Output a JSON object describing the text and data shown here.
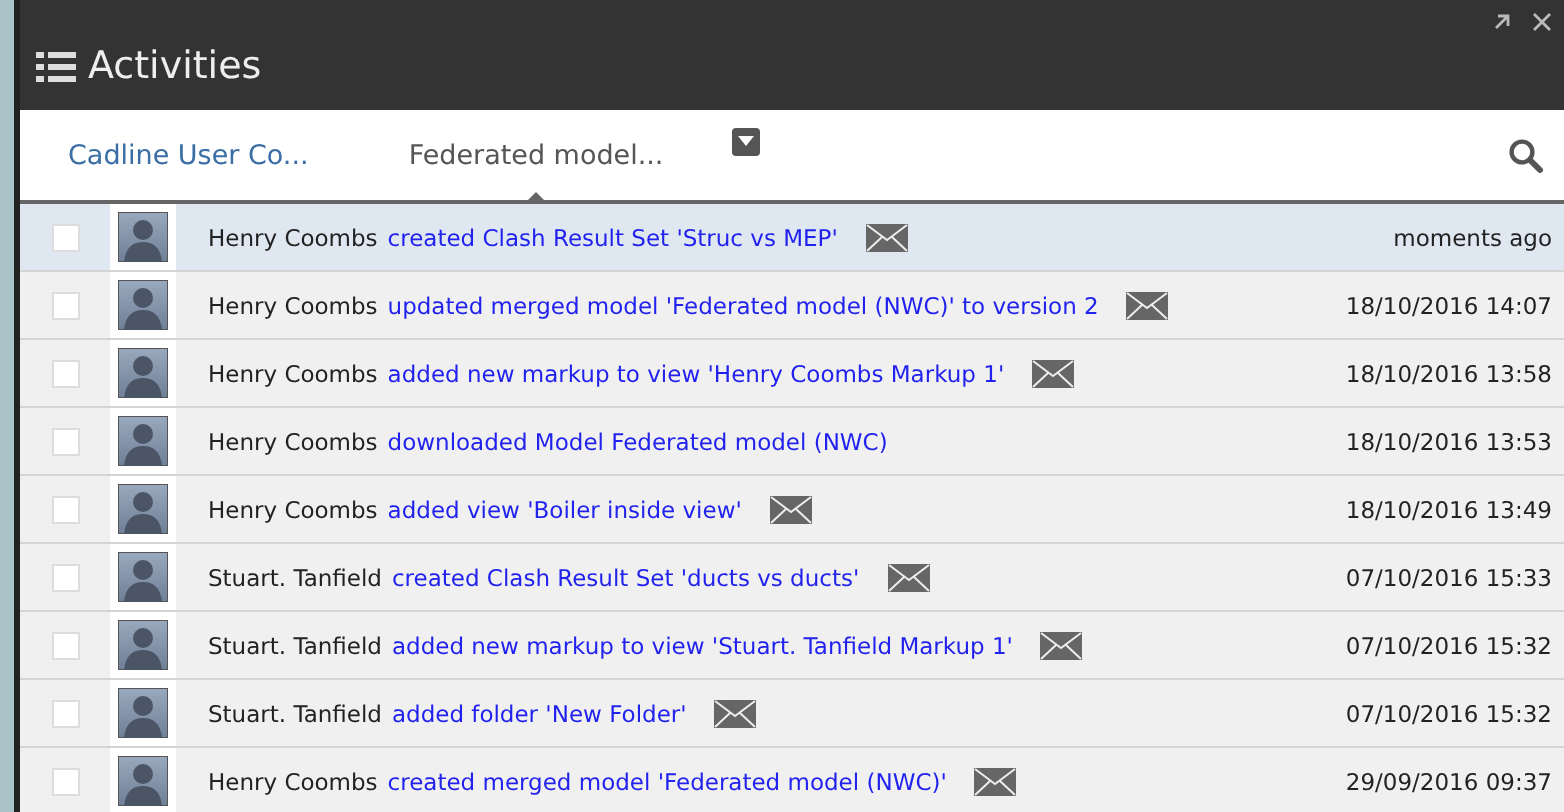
{
  "window": {
    "title": "Activities"
  },
  "tabs": [
    {
      "label": "Cadline User Co...",
      "selected": false
    },
    {
      "label": "Federated model...",
      "selected": true
    }
  ],
  "activities": [
    {
      "user": "Henry Coombs",
      "action": "created Clash Result Set 'Struc vs MEP'",
      "mail": true,
      "time": "moments ago",
      "selected": true,
      "checked": false
    },
    {
      "user": "Henry Coombs",
      "action": "updated merged model 'Federated model (NWC)' to version 2",
      "mail": true,
      "time": "18/10/2016 14:07",
      "selected": false,
      "checked": false
    },
    {
      "user": "Henry Coombs",
      "action": "added new markup to view 'Henry Coombs Markup 1'",
      "mail": true,
      "time": "18/10/2016 13:58",
      "selected": false,
      "checked": false
    },
    {
      "user": "Henry Coombs",
      "action": "downloaded Model Federated model (NWC)",
      "mail": false,
      "time": "18/10/2016 13:53",
      "selected": false,
      "checked": false
    },
    {
      "user": "Henry Coombs",
      "action": "added view 'Boiler inside view'",
      "mail": true,
      "time": "18/10/2016 13:49",
      "selected": false,
      "checked": false
    },
    {
      "user": "Stuart. Tanfield",
      "action": "created Clash Result Set 'ducts vs ducts'",
      "mail": true,
      "time": "07/10/2016 15:33",
      "selected": false,
      "checked": false
    },
    {
      "user": "Stuart. Tanfield",
      "action": "added new markup to view 'Stuart. Tanfield Markup 1'",
      "mail": true,
      "time": "07/10/2016 15:32",
      "selected": false,
      "checked": false
    },
    {
      "user": "Stuart. Tanfield",
      "action": "added folder 'New Folder'",
      "mail": true,
      "time": "07/10/2016 15:32",
      "selected": false,
      "checked": false
    },
    {
      "user": "Henry Coombs",
      "action": "created merged model 'Federated model (NWC)'",
      "mail": true,
      "time": "29/09/2016 09:37",
      "selected": false,
      "checked": false
    }
  ]
}
